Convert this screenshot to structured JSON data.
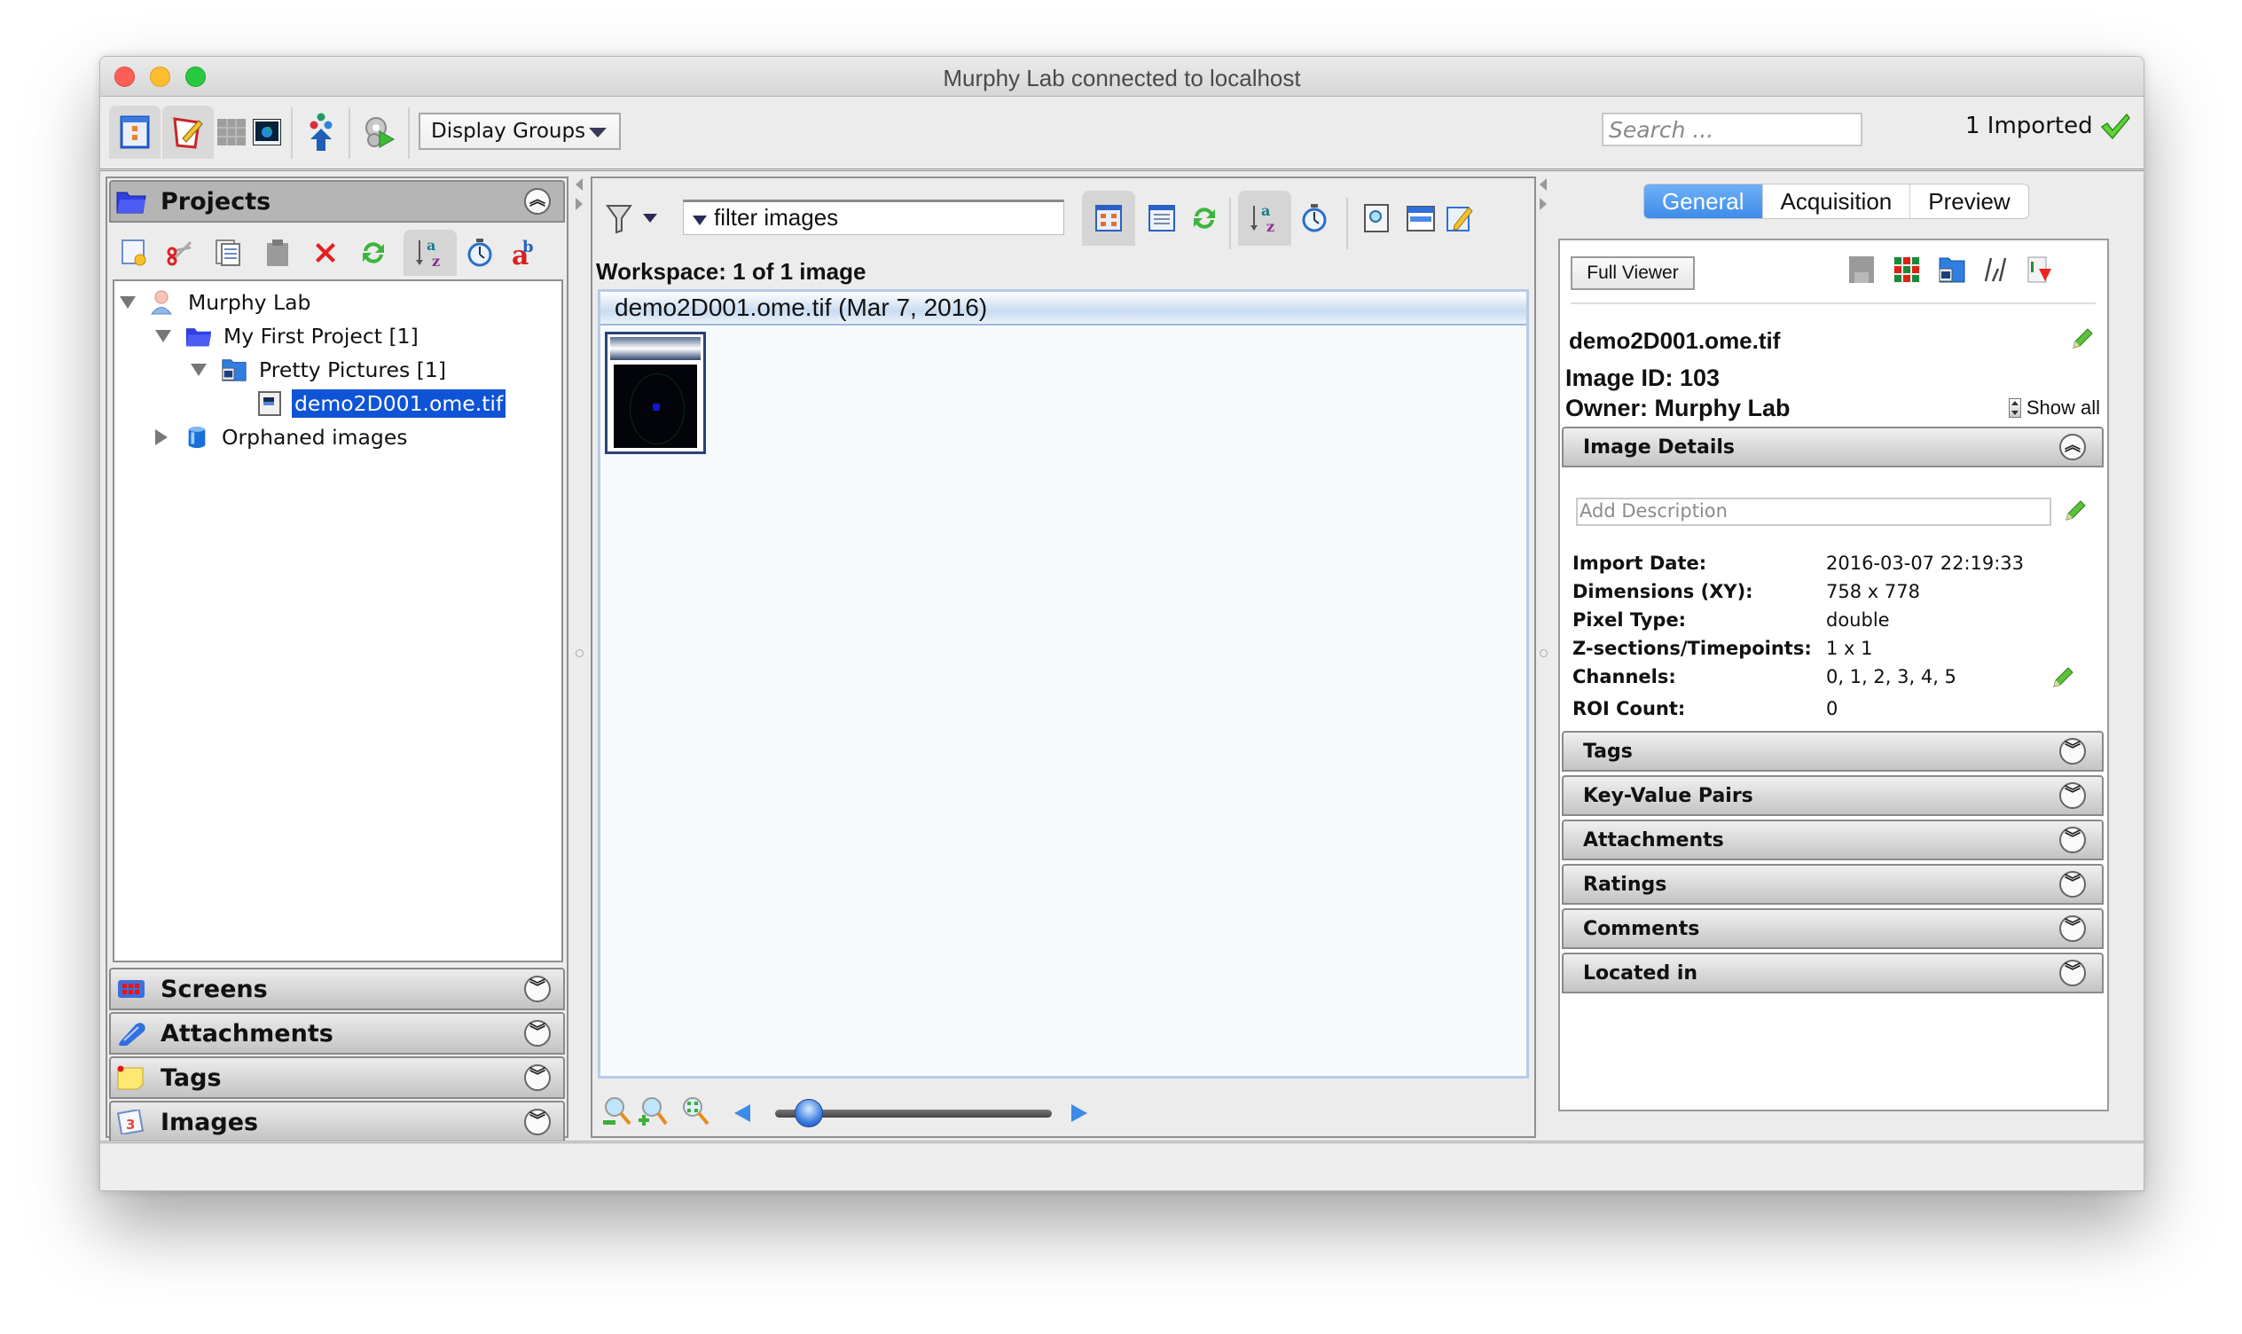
{
  "window": {
    "title": "Murphy Lab connected to localhost",
    "controls": [
      "close",
      "minimize",
      "maximize"
    ]
  },
  "toolbar": {
    "buttons": [
      {
        "name": "data-manager-icon",
        "pressed": true
      },
      {
        "name": "edit-annotations-icon",
        "pressed": true
      },
      {
        "name": "grid-view-icon",
        "pressed": false
      },
      {
        "name": "image-viewer-icon",
        "pressed": false
      },
      {
        "name": "import-icon",
        "pressed": false
      },
      {
        "name": "run-script-icon",
        "pressed": false
      }
    ],
    "display_groups_label": "Display Groups",
    "search_placeholder": "Search ...",
    "imported_status": "1 Imported",
    "imported_icon": "checkmark-icon"
  },
  "left_panel": {
    "projects_title": "Projects",
    "tools": [
      "new-icon",
      "cut-icon",
      "copy-icon",
      "paste-icon",
      "delete-icon",
      "refresh-icon",
      "sort-az-icon",
      "timer-icon",
      "text-icon"
    ],
    "tree": [
      {
        "label": "Murphy Lab",
        "level": 0,
        "expanded": true,
        "icon": "user-icon"
      },
      {
        "label": "My First Project [1]",
        "level": 1,
        "expanded": true,
        "icon": "project-folder-icon"
      },
      {
        "label": "Pretty Pictures [1]",
        "level": 2,
        "expanded": true,
        "icon": "dataset-icon"
      },
      {
        "label": "demo2D001.ome.tif",
        "level": 3,
        "selected": true,
        "icon": "image-file-icon"
      },
      {
        "label": "Orphaned images",
        "level": 1,
        "expanded": false,
        "icon": "orphan-container-icon"
      }
    ],
    "collapsed_sections": [
      {
        "label": "Screens",
        "icon": "screens-icon"
      },
      {
        "label": "Attachments",
        "icon": "attachment-icon"
      },
      {
        "label": "Tags",
        "icon": "tag-icon"
      },
      {
        "label": "Images",
        "icon": "calendar-icon"
      }
    ]
  },
  "center_panel": {
    "filter_placeholder": "filter  images",
    "workspace_label": "Workspace: 1 of 1 image",
    "group_header": "demo2D001.ome.tif (Mar 7, 2016)",
    "thumbnail_count": 1,
    "zoom_slider_fraction": 0.08
  },
  "right_panel": {
    "tabs": [
      {
        "label": "General",
        "active": true
      },
      {
        "label": "Acquisition",
        "active": false
      },
      {
        "label": "Preview",
        "active": false
      }
    ],
    "full_viewer_label": "Full Viewer",
    "image_name": "demo2D001.ome.tif",
    "image_id": "Image ID: 103",
    "owner": "Owner: Murphy Lab",
    "show_all_label": "Show all",
    "image_details_title": "Image Details",
    "description_placeholder": "Add Description",
    "details": [
      {
        "key": "Import Date:",
        "value": "2016-03-07 22:19:33"
      },
      {
        "key": "Dimensions (XY):",
        "value": "758 x 778"
      },
      {
        "key": "Pixel Type:",
        "value": "double"
      },
      {
        "key": "Z-sections/Timepoints:",
        "value": "1 x 1"
      },
      {
        "key": "Channels:",
        "value": "0, 1, 2, 3, 4, 5"
      },
      {
        "key": "ROI Count:",
        "value": "0"
      }
    ],
    "sections": [
      "Tags",
      "Key-Value Pairs",
      "Attachments",
      "Ratings",
      "Comments",
      "Located in"
    ]
  },
  "colors": {
    "selection": "#0f53d6",
    "tab_active": "#4a94ee",
    "check_green": "#4cc31d",
    "pencil_green": "#3fae28"
  }
}
